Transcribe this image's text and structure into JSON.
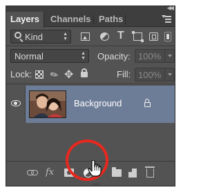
{
  "panel": {
    "tabs": [
      {
        "label": "Layers",
        "active": true
      },
      {
        "label": "Channels",
        "active": false
      },
      {
        "label": "Paths",
        "active": false
      }
    ]
  },
  "filter": {
    "kind_label": "Kind",
    "icons": [
      "image-filter-icon",
      "adjustment-filter-icon",
      "type-filter-icon",
      "shape-filter-icon",
      "smart-object-filter-icon"
    ]
  },
  "blend": {
    "mode": "Normal",
    "opacity_label": "Opacity:",
    "opacity_value": "100%"
  },
  "lock": {
    "label": "Lock:",
    "fill_label": "Fill:",
    "fill_value": "100%"
  },
  "layers": [
    {
      "name": "Background",
      "visible": true,
      "locked": true,
      "selected": true
    }
  ],
  "bottom_bar": {
    "fx_label": "fx",
    "icons": [
      "link-layers-icon",
      "layer-style-icon",
      "add-mask-icon",
      "new-adjustment-layer-icon",
      "new-group-icon",
      "new-layer-icon",
      "delete-layer-icon"
    ]
  },
  "colors": {
    "panel_bg": "#535353",
    "selected_row": "#6e7d97",
    "highlight": "#e8281e"
  }
}
